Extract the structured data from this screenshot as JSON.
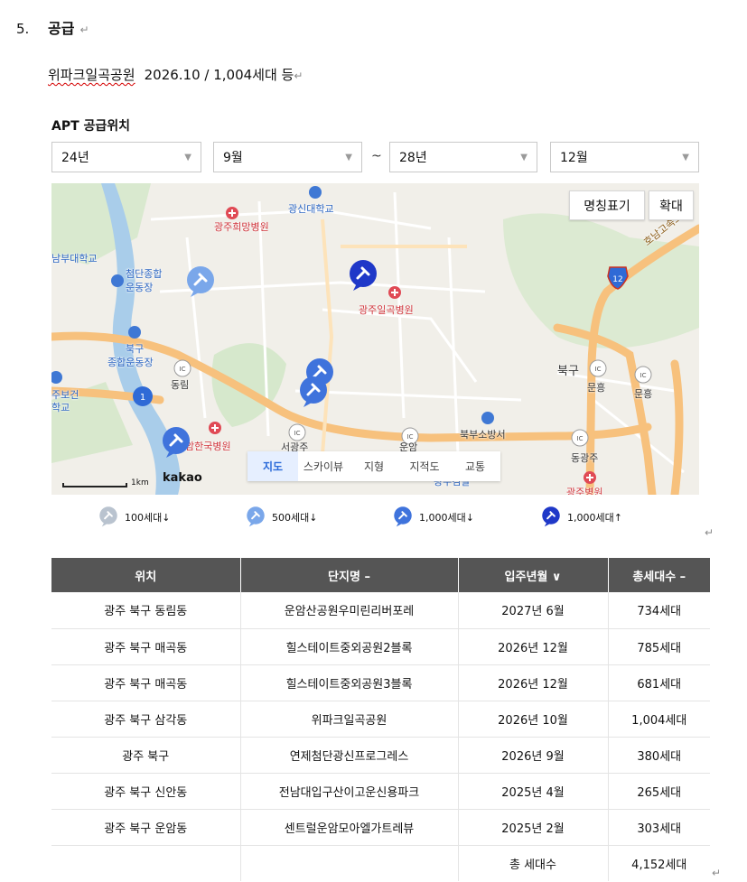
{
  "heading": {
    "number": "5.",
    "title": "공급",
    "return_mark": "↵"
  },
  "summary": {
    "complex": "위파크일곡공원",
    "detail": "2026.10 / 1,004세대  등",
    "return_mark": "↵"
  },
  "filter": {
    "label": "APT 공급위치",
    "start_year": "24년",
    "start_month": "9월",
    "separator": "~",
    "end_year": "28년",
    "end_month": "12월"
  },
  "map": {
    "labels_btn": "명칭표기",
    "zoom_btn": "확대",
    "type_tabs": [
      "지도",
      "스카이뷰",
      "지형",
      "지적도",
      "교통"
    ],
    "scale_text": "1km",
    "brand": "kakao",
    "place_labels": {
      "gwangju_univ": "광신대학교",
      "hope_hospital": "광주희망병원",
      "nambu_univ": "남부대학교",
      "cheomdan": "첨단종합",
      "stadium": "운동장",
      "ilgok_hospital": "광주일곡병원",
      "bukgu": "북구",
      "bukgu_sports": "종합운동장",
      "dongrim": "동림",
      "health1": "주보건",
      "health2": "학교",
      "hanguk_hospital": "암한국병원",
      "seogwangju": "서광주",
      "unam": "운암",
      "bukbu_fire": "북부소방서",
      "bukgu_right": "북구",
      "munheung1": "문흥",
      "munheung2": "문흥",
      "donggwangju": "동광주",
      "honam_hwy": "호남고속도로",
      "hwy_12": "12",
      "road_1": "1",
      "ic": "IC",
      "bottom_hospital": "광주병원",
      "bottom_mid": "광주검찰"
    }
  },
  "legend": [
    {
      "label": "100세대↓",
      "color": "#b9c3cf"
    },
    {
      "label": "500세대↓",
      "color": "#7aa7ea"
    },
    {
      "label": "1,000세대↓",
      "color": "#3f73dc"
    },
    {
      "label": "1,000세대↑",
      "color": "#1f38c8"
    }
  ],
  "legend_return_mark": "↵",
  "table": {
    "headers": [
      "위치",
      "단지명 –",
      "입주년월 ∨",
      "총세대수 –"
    ],
    "rows": [
      [
        "광주 북구 동림동",
        "운암산공원우미린리버포레",
        "2027년 6월",
        "734세대"
      ],
      [
        "광주 북구 매곡동",
        "힐스테이트중외공원2블록",
        "2026년 12월",
        "785세대"
      ],
      [
        "광주 북구 매곡동",
        "힐스테이트중외공원3블록",
        "2026년 12월",
        "681세대"
      ],
      [
        "광주 북구 삼각동",
        "위파크일곡공원",
        "2026년 10월",
        "1,004세대"
      ],
      [
        "광주 북구",
        "연제첨단광신프로그레스",
        "2026년 9월",
        "380세대"
      ],
      [
        "광주 북구 신안동",
        "전남대입구산이고운신용파크",
        "2025년 4월",
        "265세대"
      ],
      [
        "광주 북구 운암동",
        "센트럴운암모아엘가트레뷰",
        "2025년 2월",
        "303세대"
      ]
    ],
    "total_label": "총 세대수",
    "total_value": "4,152세대"
  },
  "table_return_mark": "↵"
}
